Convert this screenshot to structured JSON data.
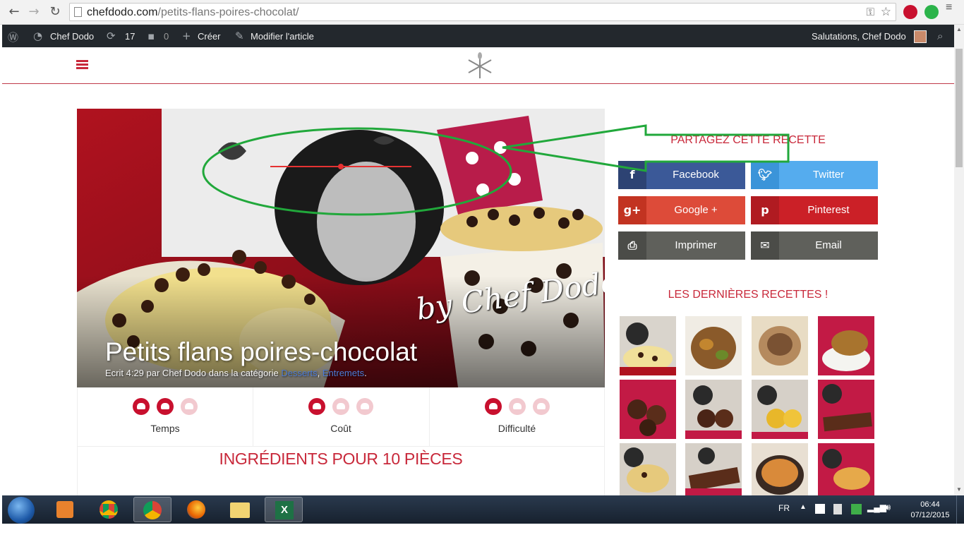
{
  "browser": {
    "url_host": "chefdodo.com",
    "url_path": "/petits-flans-poires-chocolat/"
  },
  "adminbar": {
    "site": "Chef Dodo",
    "updates": "17",
    "comments": "0",
    "create": "Créer",
    "edit": "Modifier l'article",
    "greeting": "Salutations, Chef Dodo"
  },
  "hero": {
    "title": "Petits flans poires-chocolat",
    "meta_prefix": "Ecrit 4:29 par Chef Dodo dans la catégorie",
    "cat1": "Desserts",
    "cat2": "Entremets",
    "signature": "by Chef Dodo"
  },
  "ratings": [
    {
      "label": "Temps",
      "value": 2,
      "max": 3
    },
    {
      "label": "Coût",
      "value": 1,
      "max": 3
    },
    {
      "label": "Difficulté",
      "value": 1,
      "max": 3
    }
  ],
  "ingredients_title": "INGRÉDIENTS POUR 10 PIÈCES",
  "sidebar": {
    "share_title": "PARTAGEZ CETTE RECETTE",
    "share": [
      {
        "label": "Facebook",
        "color": "#3b5998",
        "icon": "f"
      },
      {
        "label": "Twitter",
        "color": "#55acee",
        "icon": "t"
      },
      {
        "label": "Google +",
        "color": "#dd4b39",
        "icon": "g+"
      },
      {
        "label": "Pinterest",
        "color": "#cb2027",
        "icon": "p"
      },
      {
        "label": "Imprimer",
        "color": "#5f605b",
        "icon": "print"
      },
      {
        "label": "Email",
        "color": "#5f605b",
        "icon": "mail"
      }
    ],
    "latest_title": "LES DERNIÈRES RECETTES !"
  },
  "taskbar": {
    "lang": "FR",
    "time": "06:44",
    "date": "07/12/2015"
  },
  "colors": {
    "accent": "#c8283a",
    "annotation": "#21a83b"
  }
}
